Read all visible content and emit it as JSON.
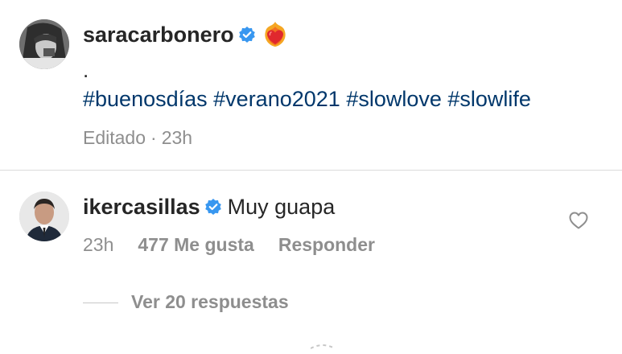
{
  "post": {
    "username": "saracarbonero",
    "caption_dot": ".",
    "hashtags": [
      "#buenosdías",
      "#verano2021",
      "#slowlove",
      "#slowlife"
    ],
    "edited_label": "Editado",
    "time": "23h"
  },
  "comment": {
    "username": "ikercasillas",
    "text": "Muy guapa",
    "time": "23h",
    "likes": "477 Me gusta",
    "reply_label": "Responder"
  },
  "view_replies": "Ver 20 respuestas",
  "colors": {
    "hashtag": "#00376b",
    "verified": "#3897f0",
    "muted": "#8e8e8e"
  },
  "icons": [
    "verified-badge-icon",
    "heart-on-fire-emoji-icon",
    "heart-outline-icon"
  ]
}
